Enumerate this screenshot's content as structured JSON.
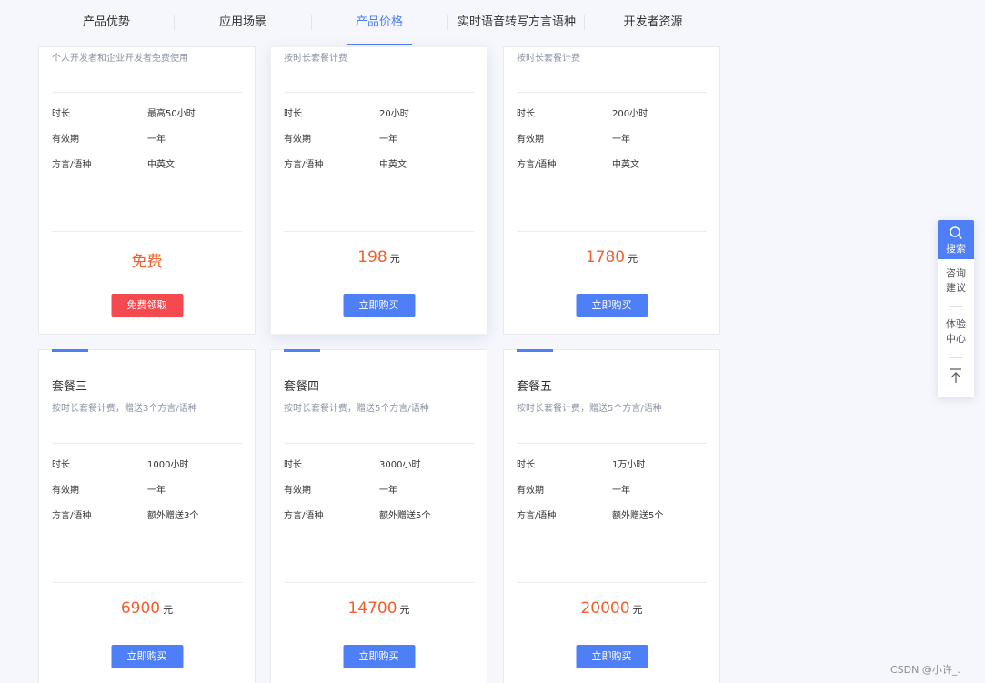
{
  "nav": {
    "items": [
      "产品优势",
      "应用场景",
      "产品价格",
      "实时语音转写方言语种",
      "开发者资源"
    ],
    "active_index": 2
  },
  "labels": {
    "duration": "时长",
    "validity": "有效期",
    "dialect": "方言/语种",
    "unit": "元"
  },
  "packages": [
    {
      "desc": "个人开发者和企业开发者免费使用",
      "duration": "最高50小时",
      "validity": "一年",
      "dialect": "中英文",
      "price": "免费",
      "button": "免费领取"
    },
    {
      "desc": "按时长套餐计费",
      "duration": "20小时",
      "validity": "一年",
      "dialect": "中英文",
      "price": "198",
      "button": "立即购买"
    },
    {
      "desc": "按时长套餐计费",
      "duration": "200小时",
      "validity": "一年",
      "dialect": "中英文",
      "price": "1780",
      "button": "立即购买"
    },
    {
      "title": "套餐三",
      "desc": "按时长套餐计费，赠送3个方言/语种",
      "duration": "1000小时",
      "validity": "一年",
      "dialect": "额外赠送3个",
      "price": "6900",
      "button": "立即购买"
    },
    {
      "title": "套餐四",
      "desc": "按时长套餐计费，赠送5个方言/语种",
      "duration": "3000小时",
      "validity": "一年",
      "dialect": "额外赠送5个",
      "price": "14700",
      "button": "立即购买"
    },
    {
      "title": "套餐五",
      "desc": "按时长套餐计费，赠送5个方言/语种",
      "duration": "1万小时",
      "validity": "一年",
      "dialect": "额外赠送5个",
      "price": "20000",
      "button": "立即购买"
    }
  ],
  "sidebar": {
    "search": "搜索",
    "consult": [
      "咨询",
      "建议"
    ],
    "experience": [
      "体验",
      "中心"
    ]
  },
  "watermark": "CSDN @小许_.",
  "colors": {
    "accent": "#4f7ff6",
    "price": "#f2602f",
    "free_button": "#f4494f"
  }
}
